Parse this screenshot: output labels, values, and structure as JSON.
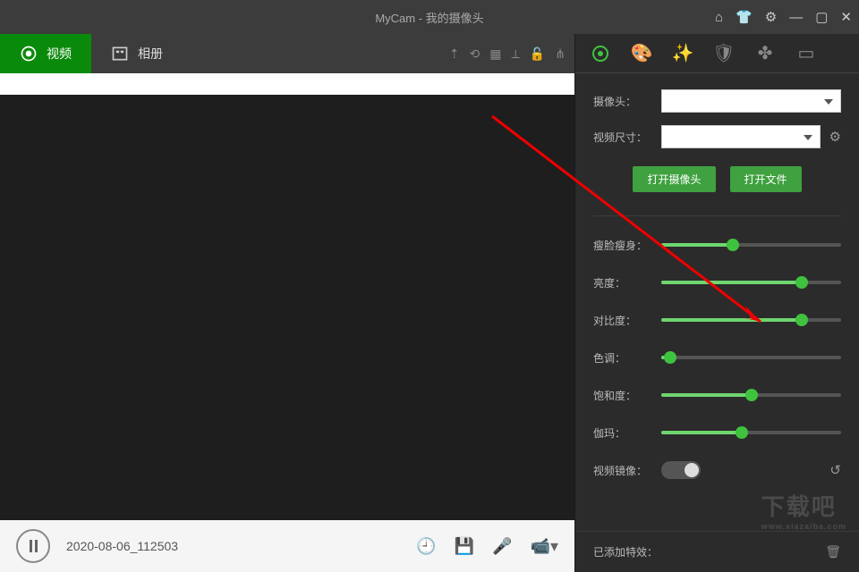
{
  "title": "MyCam - 我的摄像头",
  "tabs": {
    "video": "视频",
    "album": "相册"
  },
  "bottom": {
    "filename": "2020-08-06_112503"
  },
  "right": {
    "camera_label": "摄像头：",
    "size_label": "视频尺寸：",
    "open_camera": "打开摄像头",
    "open_file": "打开文件",
    "sliders": {
      "slim": {
        "label": "瘦脸瘦身：",
        "value": 40
      },
      "brightness": {
        "label": "亮度：",
        "value": 78
      },
      "contrast": {
        "label": "对比度：",
        "value": 78
      },
      "hue": {
        "label": "色调：",
        "value": 5
      },
      "saturation": {
        "label": "饱和度：",
        "value": 50
      },
      "gamma": {
        "label": "伽玛：",
        "value": 45
      }
    },
    "mirror_label": "视频镜像：",
    "effects_label": "已添加特效："
  },
  "watermark": {
    "main": "下载吧",
    "sub": "www.xiazaiba.com"
  }
}
